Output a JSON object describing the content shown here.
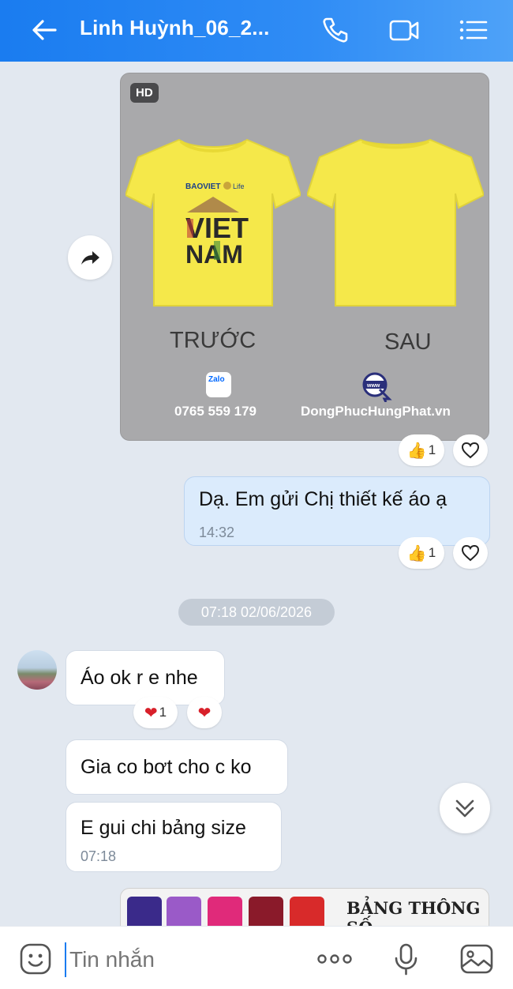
{
  "header": {
    "title": "Linh Huỳnh_06_2...",
    "icons": [
      "back-arrow-icon",
      "phone-icon",
      "video-icon",
      "menu-list-icon"
    ]
  },
  "colors": {
    "header": "#1a7cf0",
    "bubble_me": "#dbebfc",
    "background": "#e2e8f0"
  },
  "messages": {
    "image_msg": {
      "hd_badge": "HD",
      "front_caption": "TRƯỚC",
      "back_caption": "SAU",
      "phone": "0765 559 179",
      "website": "DongPhucHungPhat.vn",
      "zalo": "Zalo",
      "reaction_count": "1"
    },
    "msg1": {
      "text": "Dạ. Em gửi Chị thiết kế áo ạ",
      "time": "14:32",
      "reaction_count": "1"
    },
    "date_separator": "07:18 02/06/2026",
    "msg2": {
      "text": "Áo ok r e nhe",
      "reaction_count": "1"
    },
    "msg3": {
      "text": "Gia co bơt cho c ko"
    },
    "msg4": {
      "text": "E gui chi bảng size",
      "time": "07:18"
    },
    "size_image": {
      "title": "BẢNG THÔNG SỐ"
    }
  },
  "input": {
    "placeholder": "Tin nhắn"
  }
}
